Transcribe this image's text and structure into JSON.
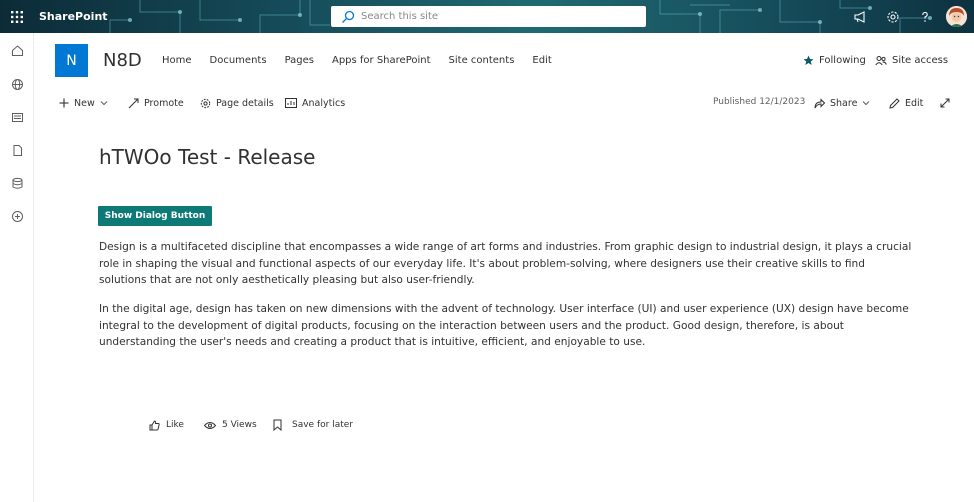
{
  "suite_bar": {
    "app_name": "SharePoint",
    "search_placeholder": "Search this site"
  },
  "site": {
    "logo_letter": "N",
    "title": "N8D",
    "nav": [
      "Home",
      "Documents",
      "Pages",
      "Apps for SharePoint",
      "Site contents",
      "Edit"
    ],
    "following_label": "Following",
    "site_access_label": "Site access"
  },
  "command_bar": {
    "new_label": "New",
    "promote_label": "Promote",
    "page_details_label": "Page details",
    "analytics_label": "Analytics",
    "published": "Published 12/1/2023",
    "share_label": "Share",
    "edit_label": "Edit"
  },
  "content": {
    "title": "hTWOo Test - Release",
    "button_label": "Show Dialog Button",
    "paragraph1": "Design is a multifaceted discipline that encompasses a wide range of art forms and industries. From graphic design to industrial design, it plays a crucial role in shaping the visual and functional aspects of our everyday life. It's about problem-solving, where designers use their creative skills to find solutions that are not only aesthetically pleasing but also user-friendly.",
    "paragraph2": "In the digital age, design has taken on new dimensions with the advent of technology. User interface (UI) and user experience (UX) design have become integral to the development of digital products, focusing on the interaction between users and the product. Good design, therefore, is about understanding the user's needs and creating a product that is intuitive, efficient, and enjoyable to use."
  },
  "social": {
    "like_label": "Like",
    "views_label": "5 Views",
    "save_label": "Save for later"
  },
  "colors": {
    "accent": "#0078d4",
    "button": "#0d7a78",
    "suite_bar": "#164c5a"
  }
}
